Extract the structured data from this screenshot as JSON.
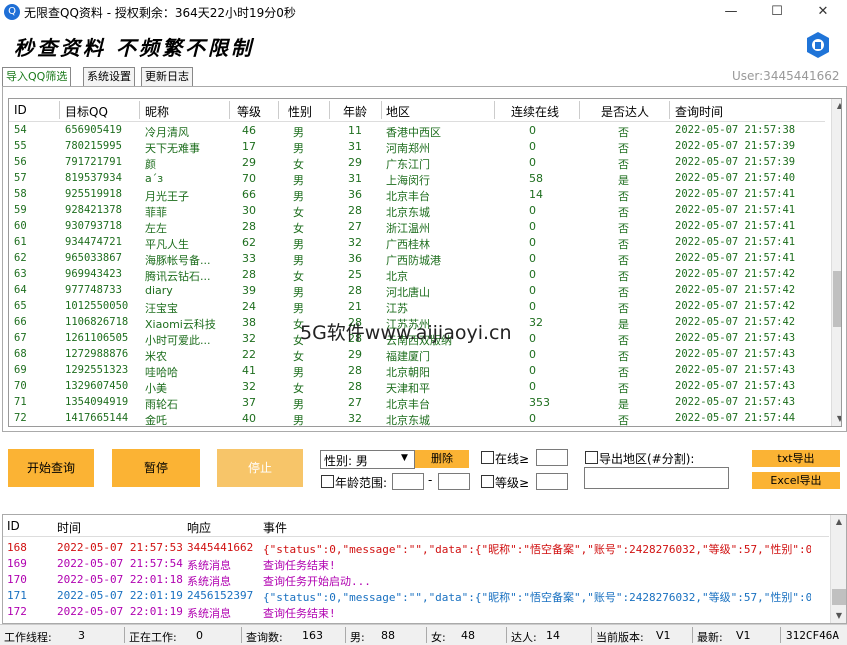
{
  "window": {
    "title": "无限查QQ资料 - 授权剩余：364天22小时19分0秒",
    "minimize": "—",
    "maximize": "☐",
    "close": "✕"
  },
  "banner": {
    "text": "秒查资料 不频繁不限制"
  },
  "tabs": [
    "导入QQ筛选",
    "系统设置",
    "更新日志"
  ],
  "user_label": "User:3445441662",
  "grid": {
    "headers": [
      "ID",
      "目标QQ",
      "昵称",
      "等级",
      "性别",
      "年龄",
      "地区",
      "连续在线",
      "是否达人",
      "查询时间"
    ],
    "rows": [
      [
        "54",
        "656905419",
        "冷月清风",
        "46",
        "男",
        "11",
        "香港中西区",
        "0",
        "否",
        "2022-05-07 21:57:38"
      ],
      [
        "55",
        "780215995",
        "天下无难事",
        "17",
        "男",
        "31",
        "河南郑州",
        "0",
        "否",
        "2022-05-07 21:57:39"
      ],
      [
        "56",
        "791721791",
        "颜",
        "29",
        "女",
        "29",
        "广东江门",
        "0",
        "否",
        "2022-05-07 21:57:39"
      ],
      [
        "57",
        "819537934",
        "a´ɜ",
        "70",
        "男",
        "31",
        "上海闵行",
        "58",
        "是",
        "2022-05-07 21:57:40"
      ],
      [
        "58",
        "925519918",
        "月光王子",
        "66",
        "男",
        "36",
        "北京丰台",
        "14",
        "否",
        "2022-05-07 21:57:41"
      ],
      [
        "59",
        "928421378",
        "菲菲",
        "30",
        "女",
        "28",
        "北京东城",
        "0",
        "否",
        "2022-05-07 21:57:41"
      ],
      [
        "60",
        "930793718",
        "左左",
        "28",
        "女",
        "27",
        "浙江温州",
        "0",
        "否",
        "2022-05-07 21:57:41"
      ],
      [
        "61",
        "934474721",
        "平凡人生",
        "62",
        "男",
        "32",
        "广西桂林",
        "0",
        "否",
        "2022-05-07 21:57:41"
      ],
      [
        "62",
        "965033867",
        "海豚帐号备...",
        "33",
        "男",
        "36",
        "广西防城港",
        "0",
        "否",
        "2022-05-07 21:57:41"
      ],
      [
        "63",
        "969943423",
        "腾讯云钻石...",
        "28",
        "女",
        "25",
        "北京",
        "0",
        "否",
        "2022-05-07 21:57:42"
      ],
      [
        "64",
        "977748733",
        "diary",
        "39",
        "男",
        "28",
        "河北唐山",
        "0",
        "否",
        "2022-05-07 21:57:42"
      ],
      [
        "65",
        "1012550050",
        "汪宝宝",
        "24",
        "男",
        "21",
        "江苏",
        "0",
        "否",
        "2022-05-07 21:57:42"
      ],
      [
        "66",
        "1106826718",
        "Xiaomi云科技",
        "38",
        "女",
        "28",
        "江苏苏州",
        "32",
        "是",
        "2022-05-07 21:57:42"
      ],
      [
        "67",
        "1261106505",
        "小时可爱此...",
        "32",
        "女",
        "28",
        "云南西双版纳",
        "0",
        "否",
        "2022-05-07 21:57:43"
      ],
      [
        "68",
        "1272988876",
        "米农",
        "22",
        "女",
        "29",
        "福建厦门",
        "0",
        "否",
        "2022-05-07 21:57:43"
      ],
      [
        "69",
        "1292551323",
        "哇哈哈",
        "41",
        "男",
        "28",
        "北京朝阳",
        "0",
        "否",
        "2022-05-07 21:57:43"
      ],
      [
        "70",
        "1329607450",
        "小美",
        "32",
        "女",
        "28",
        "天津和平",
        "0",
        "否",
        "2022-05-07 21:57:43"
      ],
      [
        "71",
        "1354094919",
        "雨轮石",
        "37",
        "男",
        "27",
        "北京丰台",
        "353",
        "是",
        "2022-05-07 21:57:43"
      ],
      [
        "72",
        "1417665144",
        "金吒",
        "40",
        "男",
        "32",
        "北京东城",
        "0",
        "否",
        "2022-05-07 21:57:44"
      ]
    ]
  },
  "controls": {
    "start": "开始查询",
    "pause": "暂停",
    "stop": "停止",
    "gender_select": "性别: 男",
    "delete": "删除",
    "online": "在线≥",
    "export_region": "导出地区(#分割):",
    "txt_export": "txt导出",
    "excel_export": "Excel导出",
    "age_range": "年龄范围:",
    "dash": "-",
    "level": "等级≥"
  },
  "log": {
    "headers": [
      "ID",
      "时间",
      "响应",
      "事件"
    ],
    "rows": [
      {
        "id": "168",
        "time": "2022-05-07 21:57:53",
        "resp": "3445441662",
        "event": "{\"status\":0,\"message\":\"\",\"data\":{\"昵称\":\"悟空备案\",\"账号\":2428276032,\"等级\":57,\"性别\":0,\"...",
        "color": "#d01010"
      },
      {
        "id": "169",
        "time": "2022-05-07 21:57:54",
        "resp": "系统消息",
        "event": "查询任务结束!",
        "color": "#b000b0"
      },
      {
        "id": "170",
        "time": "2022-05-07 22:01:18",
        "resp": "系统消息",
        "event": "查询任务开始启动...",
        "color": "#b000b0"
      },
      {
        "id": "171",
        "time": "2022-05-07 22:01:19",
        "resp": "2456152397",
        "event": "{\"status\":0,\"message\":\"\",\"data\":{\"昵称\":\"悟空备案\",\"账号\":2428276032,\"等级\":57,\"性别\":0,\"...",
        "color": "#1870c0"
      },
      {
        "id": "172",
        "time": "2022-05-07 22:01:19",
        "resp": "系统消息",
        "event": "查询任务结束!",
        "color": "#b000b0"
      }
    ]
  },
  "status": {
    "threads_label": "工作线程:",
    "threads": "3",
    "working_label": "正在工作:",
    "working": "0",
    "queries_label": "查询数:",
    "queries": "163",
    "male_label": "男:",
    "male": "88",
    "female_label": "女:",
    "female": "48",
    "talent_label": "达人:",
    "talent": "14",
    "cur_ver_label": "当前版本:",
    "cur_ver": "V1",
    "latest_label": "最新:",
    "latest": "V1",
    "code": "312CF46A"
  },
  "watermark": "5G软件www.aijiaoyi.cn"
}
